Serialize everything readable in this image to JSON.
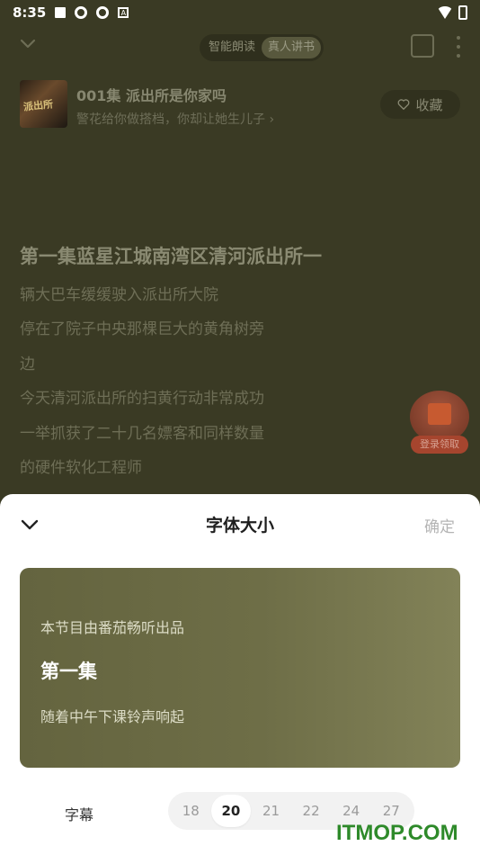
{
  "status_bar": {
    "time": "8:35"
  },
  "topbar": {
    "mode_options": [
      "智能朗读",
      "真人讲书"
    ],
    "active_mode": "真人讲书"
  },
  "episode": {
    "title": "001集 派出所是你家吗",
    "subtitle": "警花给你做搭档，你却让她生儿子",
    "subtitle_chevron": "›",
    "cover_text": "派出所",
    "favorite_label": "收藏"
  },
  "lyrics": {
    "current": "第一集蓝星江城南湾区清河派出所一",
    "lines": [
      "辆大巴车缓缓驶入派出所大院",
      "停在了院子中央那棵巨大的黄角树旁",
      "边",
      "今天清河派出所的扫黄行动非常成功",
      "一举抓获了二十几名嫖客和同样数量",
      "的硬件软化工程师"
    ]
  },
  "reward": {
    "label": "登录领取"
  },
  "sheet": {
    "title": "字体大小",
    "confirm_label": "确定",
    "preview": {
      "line1": "本节目由番茄畅听出品",
      "line2": "第一集",
      "line3": "随着中午下课铃声响起"
    },
    "size_label": "字幕",
    "sizes": [
      "18",
      "20",
      "21",
      "22",
      "24",
      "27"
    ],
    "selected_size": "20"
  },
  "watermark": "ITMOP.COM",
  "colors": {
    "background": "#3a3a24",
    "preview_bg": "#6e6e47",
    "watermark": "#2e8a2a"
  },
  "icons": [
    "chevron-down-icon",
    "shopping-bag-icon",
    "more-icon",
    "heart-icon",
    "gift-icon",
    "wifi-icon",
    "battery-icon"
  ]
}
